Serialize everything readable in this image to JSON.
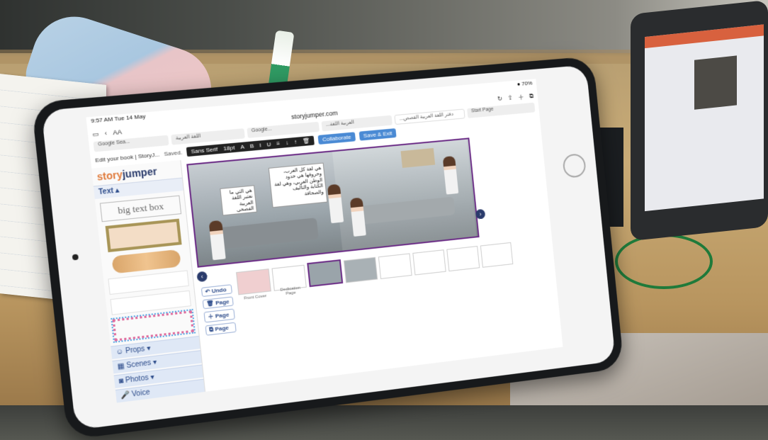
{
  "status_bar": {
    "time": "9:57 AM  Tue 14 May",
    "battery": "● 70%"
  },
  "browser": {
    "aa_label": "AA",
    "url": "storyjumper.com",
    "tabs": [
      "Google Sea...",
      "اللغة العربية",
      "Google...",
      "...العربية اللغة",
      "...دفتر اللغة العربية القصص"
    ],
    "start_page": "Start Page"
  },
  "app": {
    "tab_title": "Edit your book | StoryJ...",
    "saved": "Saved.",
    "logo_story": "story",
    "logo_jumper": "jumper",
    "font": "Sans Serif",
    "font_size": "18pt",
    "format_buttons": [
      "A",
      "B",
      "I",
      "U"
    ],
    "collaborate": "Collaborate",
    "save_exit": "Save & Exit"
  },
  "panel": {
    "text_section": "Text",
    "big_text_box": "big text box",
    "props": "Props",
    "scenes": "Scenes",
    "photos": "Photos",
    "voice": "Voice"
  },
  "canvas": {
    "bubble_main": "هي لغة كل العرب، وحروفها هي حدود الوطن العربي، وهي لغة الكتابة والتأليف والصحافة",
    "bubble_small": "هي التي ما نعتبر اللغة العربية الفصحى"
  },
  "controls": {
    "undo": "Undo",
    "page_copy": "Page",
    "page_add": "Page",
    "page_dup": "Page"
  },
  "thumbs": {
    "front": "Front Cover",
    "dedication": "Dedication Page"
  }
}
